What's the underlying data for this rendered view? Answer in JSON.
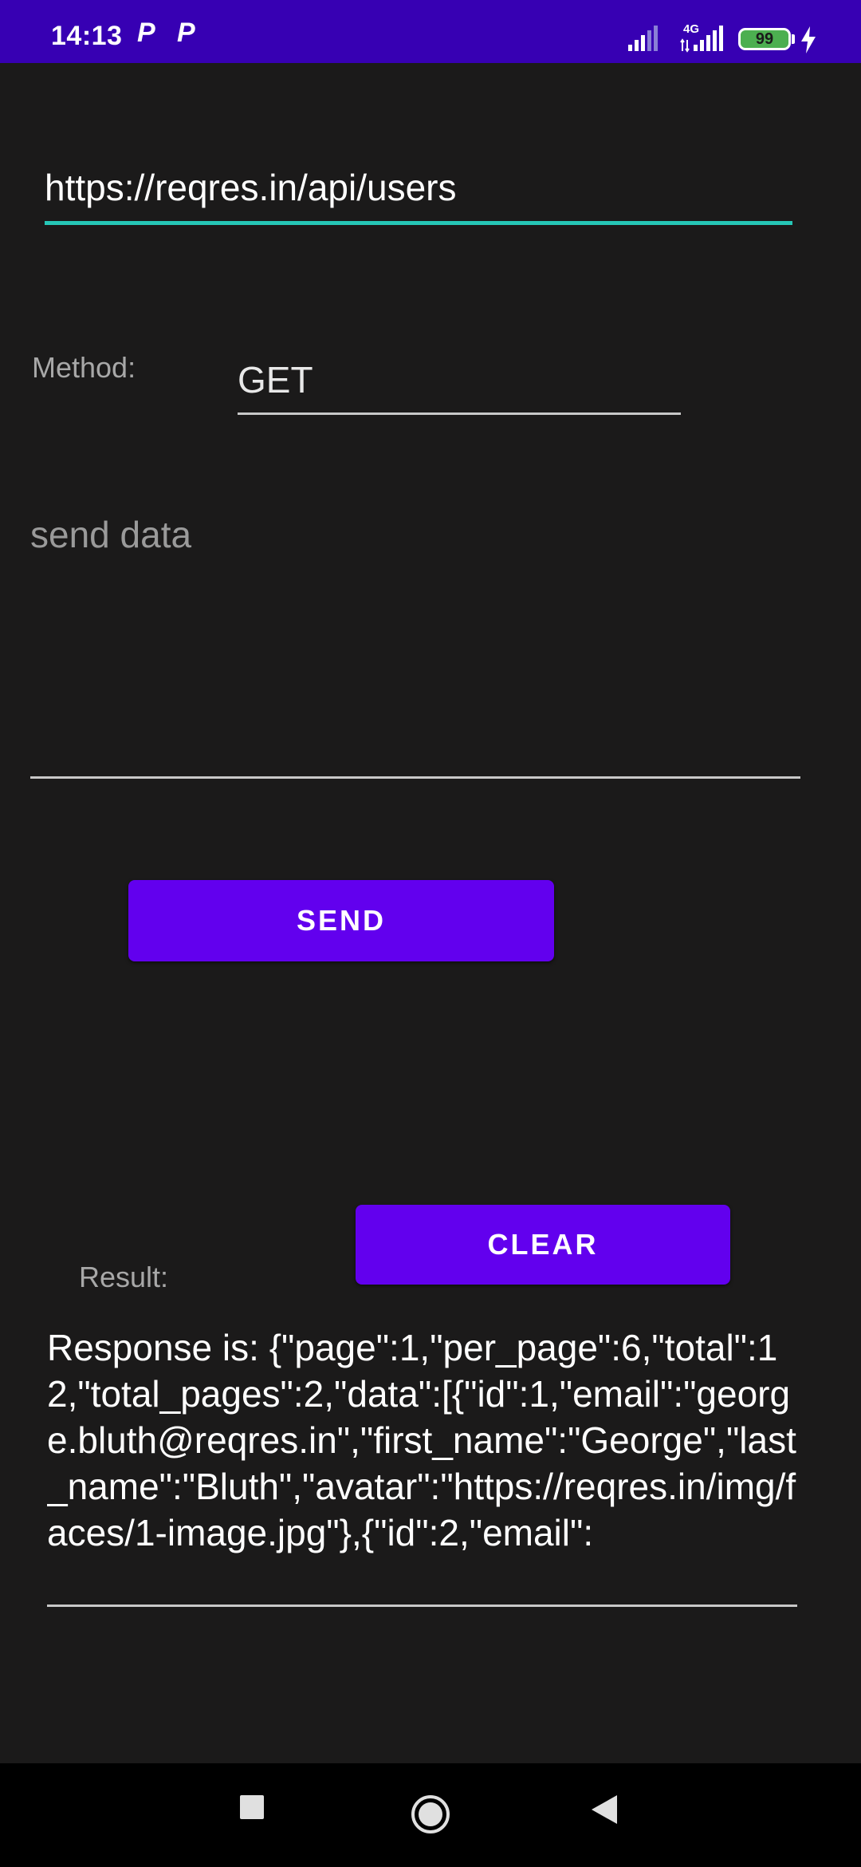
{
  "status_bar": {
    "time": "14:13",
    "notification_icons": [
      "P",
      "P"
    ],
    "network_label": "4G",
    "battery_level": "99",
    "charging": true
  },
  "form": {
    "url_value": "https://reqres.in/api/users",
    "method_label": "Method:",
    "method_value": "GET",
    "data_placeholder": "send data",
    "send_label": "SEND",
    "clear_label": "CLEAR",
    "result_label": "Result:",
    "response_text": "Response is: {\"page\":1,\"per_page\":6,\"total\":12,\"total_pages\":2,\"data\":[{\"id\":1,\"email\":\"george.bluth@reqres.in\",\"first_name\":\"George\",\"last_name\":\"Bluth\",\"avatar\":\"https://reqres.in/img/faces/1-image.jpg\"},{\"id\":2,\"email\":"
  },
  "nav": {
    "icons": [
      "recents-icon",
      "home-icon",
      "back-icon"
    ]
  },
  "colors": {
    "status_bar": "#3700b3",
    "background": "#1b1a1a",
    "accent": "#6200ee",
    "focus_underline": "#26c6b6",
    "battery": "#4caf50"
  }
}
